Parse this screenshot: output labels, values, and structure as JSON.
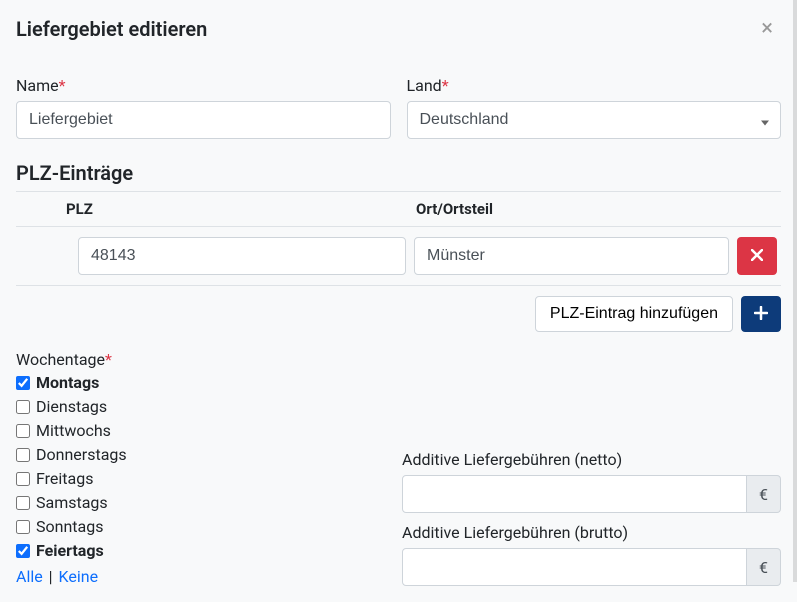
{
  "header": {
    "title": "Liefergebiet editieren"
  },
  "name": {
    "label": "Name",
    "value": "Liefergebiet"
  },
  "land": {
    "label": "Land",
    "value": "Deutschland"
  },
  "plz_section": {
    "title": "PLZ-Einträge",
    "col_plz": "PLZ",
    "col_ort": "Ort/Ortsteil",
    "rows": [
      {
        "plz": "48143",
        "ort": "Münster"
      }
    ],
    "add_label": "PLZ-Eintrag hinzufügen"
  },
  "weekdays": {
    "label": "Wochentage",
    "items": [
      {
        "label": "Montags",
        "checked": true
      },
      {
        "label": "Dienstags",
        "checked": false
      },
      {
        "label": "Mittwochs",
        "checked": false
      },
      {
        "label": "Donnerstags",
        "checked": false
      },
      {
        "label": "Freitags",
        "checked": false
      },
      {
        "label": "Samstags",
        "checked": false
      },
      {
        "label": "Sonntags",
        "checked": false
      },
      {
        "label": "Feiertags",
        "checked": true
      }
    ],
    "all": "Alle",
    "none": "Keine"
  },
  "fees": {
    "netto_label": "Additive Liefergebühren (netto)",
    "brutto_label": "Additive Liefergebühren (brutto)",
    "currency": "€",
    "netto_value": "",
    "brutto_value": ""
  },
  "asterisk": "*"
}
